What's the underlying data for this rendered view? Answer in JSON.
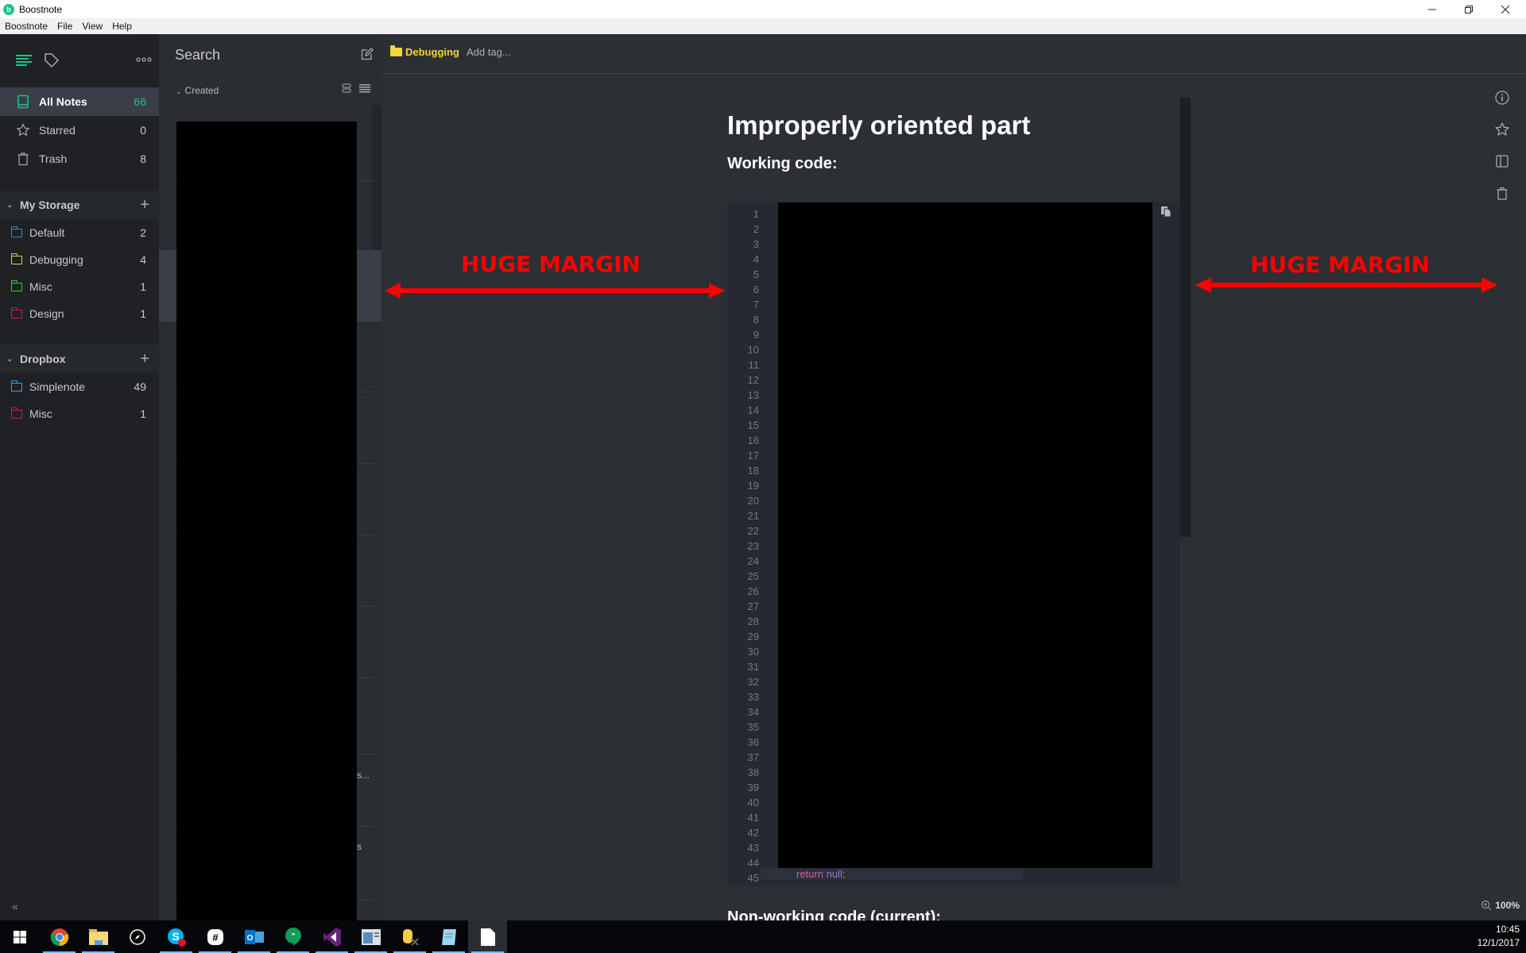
{
  "window": {
    "title": "Boostnote",
    "controls": [
      "minimize",
      "restore",
      "close"
    ]
  },
  "menubar": [
    "Boostnote",
    "File",
    "View",
    "Help"
  ],
  "sidebar": {
    "nav": [
      {
        "label": "All Notes",
        "count": "66",
        "icon": "book-icon",
        "active": true
      },
      {
        "label": "Starred",
        "count": "0",
        "icon": "star-icon",
        "active": false
      },
      {
        "label": "Trash",
        "count": "8",
        "icon": "trash-icon",
        "active": false
      }
    ],
    "storages": [
      {
        "name": "My Storage",
        "folders": [
          {
            "label": "Default",
            "count": "2",
            "color": "#2d88d5"
          },
          {
            "label": "Debugging",
            "count": "4",
            "color": "#e6cf3e"
          },
          {
            "label": "Misc",
            "count": "1",
            "color": "#3cc93c"
          },
          {
            "label": "Design",
            "count": "1",
            "color": "#d2174f"
          }
        ]
      },
      {
        "name": "Dropbox",
        "folders": [
          {
            "label": "Simplenote",
            "count": "49",
            "color": "#35a3e8"
          },
          {
            "label": "Misc",
            "count": "1",
            "color": "#d2174f"
          }
        ]
      }
    ],
    "collapse_label": "«"
  },
  "notelist": {
    "search_label": "Search",
    "sort_label": "Created",
    "fragments": [
      "s...",
      "s"
    ]
  },
  "editor": {
    "folder": "Debugging",
    "folder_color": "#f5d33a",
    "add_tag": "Add tag...",
    "title": "Improperly oriented part",
    "heading1": "Working code:",
    "heading2": "Non-working code (current):",
    "line_numbers": [
      "1",
      "2",
      "3",
      "4",
      "5",
      "6",
      "7",
      "8",
      "9",
      "10",
      "11",
      "12",
      "13",
      "14",
      "15",
      "16",
      "17",
      "18",
      "19",
      "20",
      "21",
      "22",
      "23",
      "24",
      "25",
      "26",
      "27",
      "28",
      "29",
      "30",
      "31",
      "32",
      "33",
      "34",
      "35",
      "36",
      "37",
      "38",
      "39",
      "40",
      "41",
      "42",
      "43",
      "44",
      "45"
    ],
    "last_line": {
      "keyword": "return",
      "value": "null",
      "punct": ";"
    },
    "zoom": "100%"
  },
  "annotations": {
    "left": "HUGE MARGIN",
    "right": "HUGE MARGIN",
    "color": "#ff0000"
  },
  "taskbar": {
    "apps": [
      "start",
      "chrome",
      "file-explorer",
      "compass",
      "skype",
      "slack",
      "outlook",
      "hangouts",
      "visual-studio",
      "app-window",
      "database-tool",
      "notepad",
      "boostnote-file"
    ],
    "time": "10:45",
    "date": "12/1/2017"
  }
}
